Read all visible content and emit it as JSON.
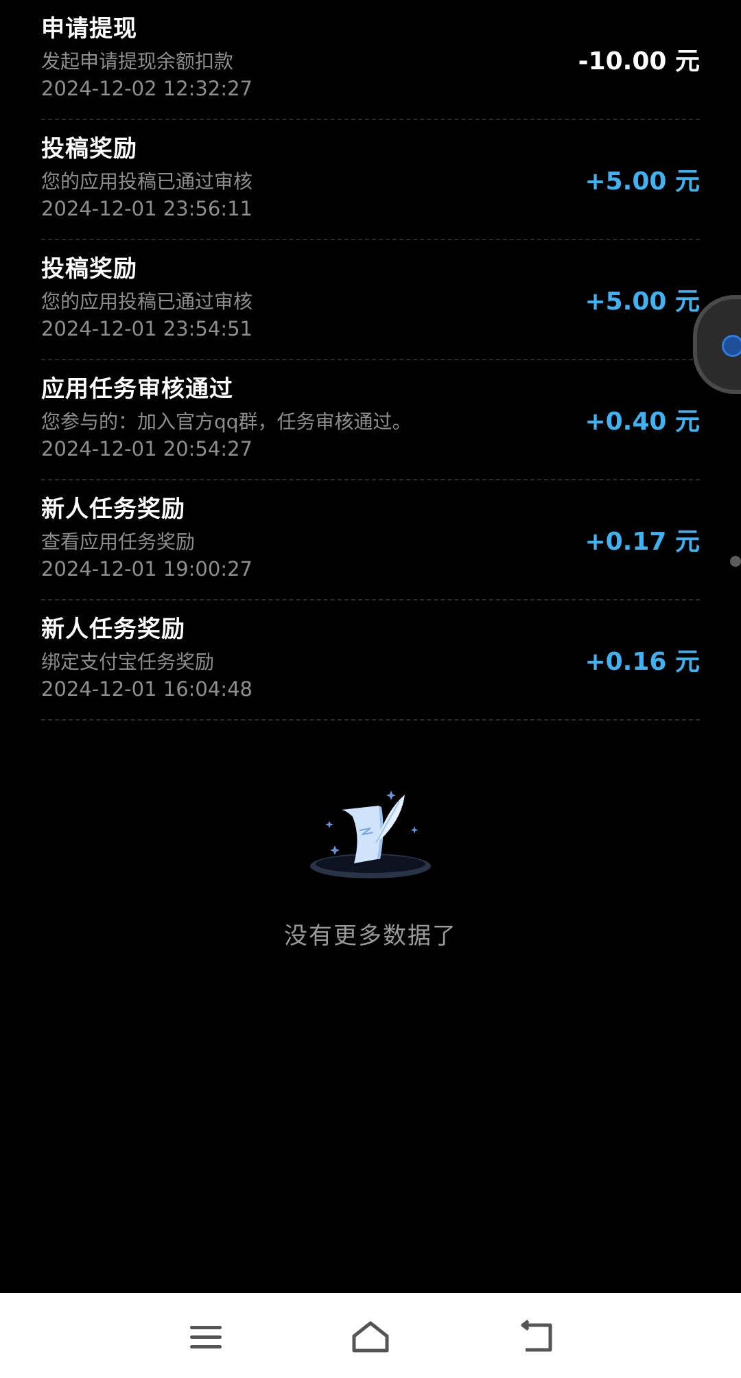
{
  "transactions": [
    {
      "title": "申请提现",
      "desc": "发起申请提现余额扣款",
      "time": "2024-12-02 12:32:27",
      "amount": "-10.00 元",
      "type": "neg"
    },
    {
      "title": "投稿奖励",
      "desc": "您的应用投稿已通过审核",
      "time": "2024-12-01 23:56:11",
      "amount": "+5.00 元",
      "type": "pos"
    },
    {
      "title": "投稿奖励",
      "desc": "您的应用投稿已通过审核",
      "time": "2024-12-01 23:54:51",
      "amount": "+5.00 元",
      "type": "pos"
    },
    {
      "title": "应用任务审核通过",
      "desc": "您参与的：加入官方qq群，任务审核通过。",
      "time": "2024-12-01 20:54:27",
      "amount": "+0.40 元",
      "type": "pos"
    },
    {
      "title": "新人任务奖励",
      "desc": "查看应用任务奖励",
      "time": "2024-12-01 19:00:27",
      "amount": "+0.17 元",
      "type": "pos"
    },
    {
      "title": "新人任务奖励",
      "desc": "绑定支付宝任务奖励",
      "time": "2024-12-01 16:04:48",
      "amount": "+0.16 元",
      "type": "pos"
    }
  ],
  "empty_state": {
    "text": "没有更多数据了",
    "icon": "paper-quill-illustration"
  },
  "navbar": {
    "menu_icon": "menu-icon",
    "home_icon": "home-icon",
    "back_icon": "back-icon"
  },
  "colors": {
    "background": "#000000",
    "positive_amount": "#3fb3f2",
    "negative_amount": "#ffffff",
    "secondary_text": "#8e8e8e"
  }
}
